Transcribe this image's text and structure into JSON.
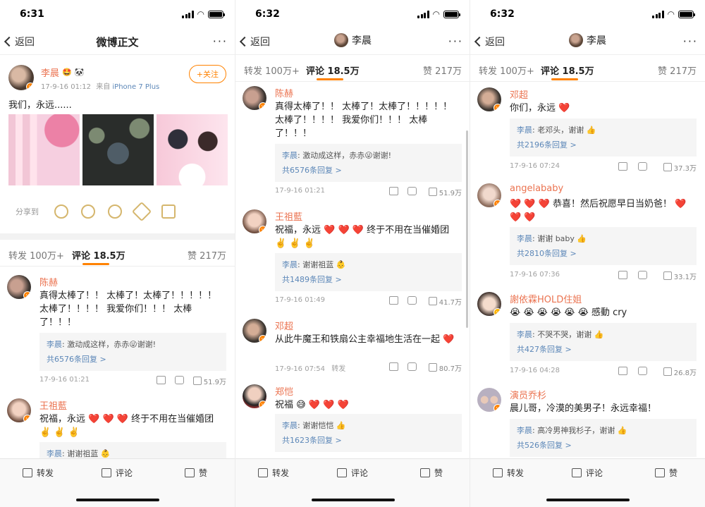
{
  "p1": {
    "time": "6:31",
    "back": "返回",
    "title": "微博正文",
    "more": "···",
    "post": {
      "author": "李晨",
      "time": "17-9-16 01:12",
      "from_prefix": "来自",
      "device": "iPhone 7 Plus",
      "text": "我们，永远......",
      "follow": "+关注"
    },
    "share_label": "分享到",
    "tabs": {
      "repost": "转发 100万+",
      "comment": "评论 18.5万",
      "like": "赞 217万"
    },
    "comments": [
      {
        "name": "陈赫",
        "text": "真得太棒了！！ 太棒了！太棒了！！！！！ 太棒了！！！！ 我爱你们！！！ 太棒了！！！",
        "reply_author": "李晨",
        "reply_text": "激动成这样，赤赤😜谢谢!",
        "reply_count": "共6576条回复 >",
        "time": "17-9-16 01:21",
        "likes": "51.9万"
      },
      {
        "name": "王祖藍",
        "text": "祝福，永远 ❤️ ❤️ ❤️ 终于不用在当催婚团 ✌️ ✌️ ✌️",
        "reply_author": "李晨",
        "reply_text": "谢谢祖蓝 👶"
      }
    ]
  },
  "p2": {
    "time": "6:32",
    "back": "返回",
    "user": "李晨",
    "more": "···",
    "tabs": {
      "repost": "转发 100万+",
      "comment": "评论 18.5万",
      "like": "赞 217万"
    },
    "comments": [
      {
        "name": "陈赫",
        "text": "真得太棒了！！ 太棒了！太棒了！！！！！ 太棒了！！！！ 我爱你们！！！ 太棒了！！！",
        "reply_author": "李晨",
        "reply_text": "激动成这样，赤赤😜谢谢!",
        "reply_count": "共6576条回复 >",
        "time": "17-9-16 01:21",
        "extra": "",
        "likes": "51.9万"
      },
      {
        "name": "王祖藍",
        "text": "祝福，永远 ❤️ ❤️ ❤️ 终于不用在当催婚团 ✌️ ✌️ ✌️",
        "reply_author": "李晨",
        "reply_text": "谢谢祖蓝 👶",
        "reply_count": "共1489条回复 >",
        "time": "17-9-16 01:49",
        "extra": "",
        "likes": "41.7万"
      },
      {
        "name": "邓超",
        "text": "从此牛魔王和铁扇公主幸福地生活在一起 ❤️",
        "time": "17-9-16 07:54",
        "extra": "转发",
        "likes": "80.7万"
      },
      {
        "name": "郑恺",
        "text": "祝福 😅 ❤️ ❤️ ❤️",
        "reply_author": "李晨",
        "reply_text": "谢谢恺恺 👍",
        "reply_count": "共1623条回复 >"
      }
    ]
  },
  "p3": {
    "time": "6:32",
    "back": "返回",
    "user": "李晨",
    "more": "···",
    "tabs": {
      "repost": "转发 100万+",
      "comment": "评论 18.5万",
      "like": "赞 217万"
    },
    "comments": [
      {
        "name": "邓超",
        "text": "你们，永远 ❤️",
        "reply_author": "李晨",
        "reply_text": "老邓头，谢谢 👍",
        "reply_count": "共2196条回复 >",
        "time": "17-9-16 07:24",
        "likes": "37.3万"
      },
      {
        "name": "angelababy",
        "text": "❤️ ❤️ ❤️ 恭喜！然后祝愿早日当奶爸！ ❤️ ❤️ ❤️",
        "reply_author": "李晨",
        "reply_text": "谢谢 baby 👍",
        "reply_count": "共2810条回复 >",
        "time": "17-9-16 07:36",
        "likes": "33.1万"
      },
      {
        "name": "謝依霖HOLD住姐",
        "text": "😭 😭 😭 😭 😭 😭 感動 cry",
        "reply_author": "李晨",
        "reply_text": "不哭不哭，谢谢 👍",
        "reply_count": "共427条回复 >",
        "time": "17-9-16 04:28",
        "likes": "26.8万"
      },
      {
        "name": "演员乔杉",
        "text": "晨儿哥，冷漠的美男子！永远幸福！",
        "reply_author": "李晨",
        "reply_text": "高冷男神我杉子，谢谢 👍",
        "reply_count": "共526条回复 >"
      }
    ]
  },
  "bottom": {
    "repost": "转发",
    "comment": "评论",
    "like": "赞"
  },
  "colors": {
    "accent": "#ff8200",
    "name": "#eb7350",
    "link": "#5c87b8"
  }
}
